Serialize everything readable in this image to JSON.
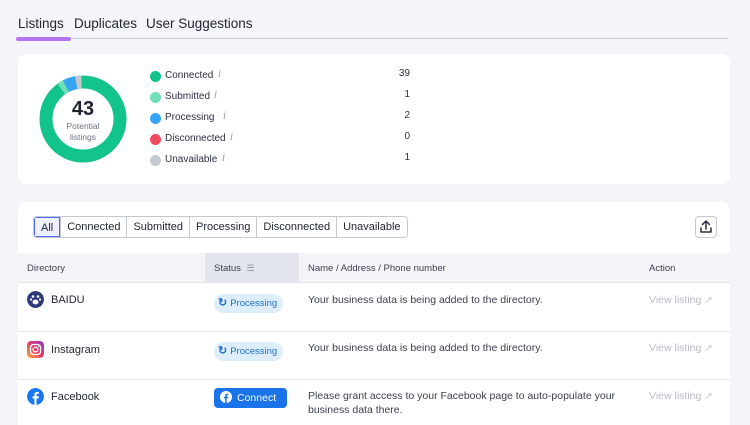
{
  "tabs": [
    {
      "label": "Listings",
      "active": true
    },
    {
      "label": "Duplicates",
      "active": false
    },
    {
      "label": "User Suggestions",
      "active": false
    }
  ],
  "summary": {
    "total": "43",
    "total_caption_line1": "Potential",
    "total_caption_line2": "listings",
    "legend": [
      {
        "label": "Connected",
        "count": "39",
        "color": "#12c48b"
      },
      {
        "label": "Submitted",
        "count": "1",
        "color": "#6fe0b8"
      },
      {
        "label": "Processing",
        "count": "2",
        "color": "#36a4f5"
      },
      {
        "label": "Disconnected",
        "count": "0",
        "color": "#f04a5e"
      },
      {
        "label": "Unavailable",
        "count": "1",
        "color": "#c4c8d0"
      }
    ],
    "info_icon": "info-icon"
  },
  "filters": [
    "All",
    "Connected",
    "Submitted",
    "Processing",
    "Disconnected",
    "Unavailable"
  ],
  "active_filter": "All",
  "table": {
    "headers": {
      "directory": "Directory",
      "status": "Status",
      "name": "Name / Address / Phone number",
      "action": "Action"
    },
    "rows": [
      {
        "directory": "BAIDU",
        "icon": "baidu-icon",
        "status_type": "pill",
        "status": "Processing",
        "description": "Your business data is being added to the directory.",
        "action": "View listing"
      },
      {
        "directory": "Instagram",
        "icon": "instagram-icon",
        "status_type": "pill",
        "status": "Processing",
        "description": "Your business data is being added to the directory.",
        "action": "View listing"
      },
      {
        "directory": "Facebook",
        "icon": "facebook-icon",
        "status_type": "button",
        "status": "Connect",
        "description": "Please grant access to your Facebook page to auto-populate your business data there.",
        "action": "View listing"
      }
    ]
  }
}
